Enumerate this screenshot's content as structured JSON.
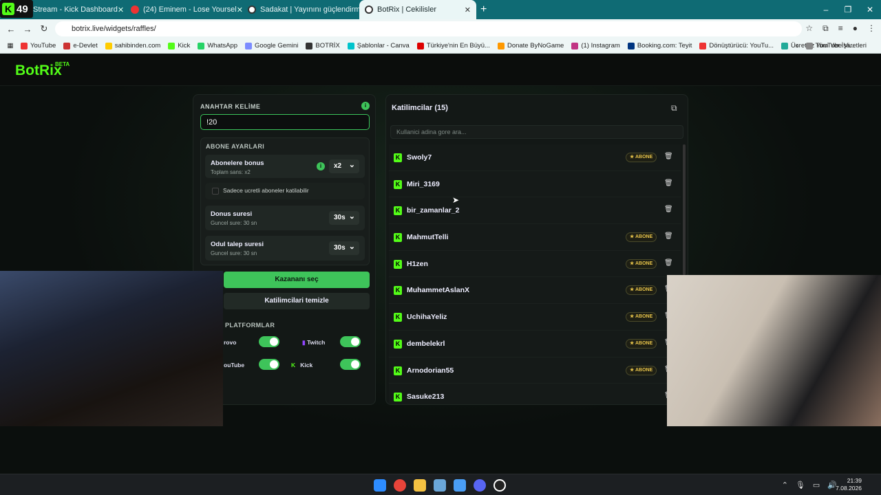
{
  "browser": {
    "badge_number": "49",
    "tabs": [
      {
        "title": "Stream - Kick Dashboard"
      },
      {
        "title": "(24) Eminem - Lose Yoursel"
      },
      {
        "title": "Sadakat | Yayınını güçlendirme"
      },
      {
        "title": "BotRix | Cekilisler"
      }
    ],
    "new_tab": "+",
    "url": "botrix.live/widgets/raffles/",
    "bookmarks": [
      "YouTube",
      "e-Devlet",
      "sahibinden.com",
      "Kick",
      "WhatsApp",
      "Google Gemini",
      "BOTRİX",
      "Şablonlar - Canva",
      "Türkiye'nin En Büyü...",
      "Donate ByNoGame",
      "(1) Instagram",
      "Booking.com: Teyit",
      "Dönüştürücü: YouTu...",
      "Ücretsiz YouTube Vi..."
    ],
    "bookmarks_more": "»",
    "all_bookmarks": "Tüm Yer İşaretleri"
  },
  "app": {
    "logo": "BotRix",
    "logo_beta": "BETA"
  },
  "settings": {
    "keyword_label": "ANAHTAR KELİME",
    "keyword_value": "!20",
    "subscriber_title": "ABONE AYARLARI",
    "bonus_title": "Abonelere bonus",
    "bonus_sub": "Toplam sans: x2",
    "bonus_value": "x2",
    "paid_only_label": "Sadece ucretli aboneler katilabilir",
    "bonus_time_title": "Donus suresi",
    "bonus_time_sub": "Guncel sure: 30 sn",
    "bonus_time_value": "30s",
    "claim_title": "Odul talep suresi",
    "claim_sub": "Guncel sure: 30 sn",
    "claim_value": "30s",
    "pick_winner": "Kazananı seç",
    "clear_participants": "Katilimcilari temizle",
    "platforms_label": "PLATFORMLAR",
    "platforms": [
      {
        "name": "rovo",
        "enabled": true
      },
      {
        "name": "Twitch",
        "enabled": true
      },
      {
        "name": "ouTube",
        "enabled": true
      },
      {
        "name": "Kick",
        "enabled": true
      }
    ]
  },
  "participants": {
    "title": "Katilimcilar (15)",
    "search_placeholder": "Kullanici adina gore ara...",
    "sub_badge": "ABONE",
    "rows": [
      {
        "name": "Swoly7",
        "sub": true
      },
      {
        "name": "Miri_3169",
        "sub": false
      },
      {
        "name": "bir_zamanlar_2",
        "sub": false
      },
      {
        "name": "MahmutTelli",
        "sub": true
      },
      {
        "name": "H1zen",
        "sub": true
      },
      {
        "name": "MuhammetAslanX",
        "sub": true
      },
      {
        "name": "UchihaYeliz",
        "sub": true
      },
      {
        "name": "dembelekrl",
        "sub": true
      },
      {
        "name": "Arnodorian55",
        "sub": true
      },
      {
        "name": "Sasuke213",
        "sub": false
      }
    ]
  },
  "taskbar": {
    "time": "21:39",
    "date": "7.08.2026"
  },
  "colors": {
    "accent": "#3ec45a",
    "kick_green": "#53fc18",
    "tab_bar": "#0f6b74"
  }
}
